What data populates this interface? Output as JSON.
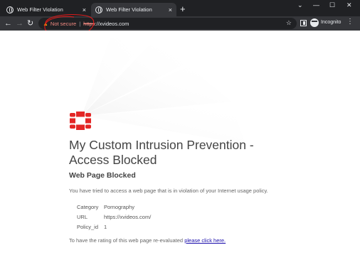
{
  "browser": {
    "tabs": [
      {
        "title": "Web Filter Violation",
        "close": "×"
      },
      {
        "title": "Web Filter Violation",
        "close": "×"
      }
    ],
    "new_tab": "+",
    "window_controls": {
      "chevron": "⌄",
      "minimize": "—",
      "maximize": "☐",
      "close": "✕"
    },
    "nav": {
      "back": "←",
      "forward": "→",
      "reload": "↻"
    },
    "address_bar": {
      "security_warning": "Not secure",
      "separator": "|",
      "scheme": "https",
      "host": "://xvideos.com"
    },
    "bookmark_icon": "☆",
    "incognito_label": "Incognito",
    "menu_icon": "⋮"
  },
  "page": {
    "title": "My Custom Intrusion Prevention - Access Blocked",
    "subtitle": "Web Page Blocked",
    "message": "You have tried to access a web page that is in violation of your Internet usage policy.",
    "details": [
      {
        "label": "Category",
        "value": "Pornography"
      },
      {
        "label": "URL",
        "value": "https://xvideos.com/"
      },
      {
        "label": "Policy_id",
        "value": "1"
      }
    ],
    "footer_text": "To have the rating of this web page re-evaluated ",
    "footer_link": "please click here."
  },
  "colors": {
    "tabstrip_bg": "#202124",
    "toolbar_bg": "#35363a",
    "not_secure": "#f28b82",
    "logo_red": "#e32726",
    "link": "#1a0dab",
    "annotation": "#d81b1b"
  }
}
